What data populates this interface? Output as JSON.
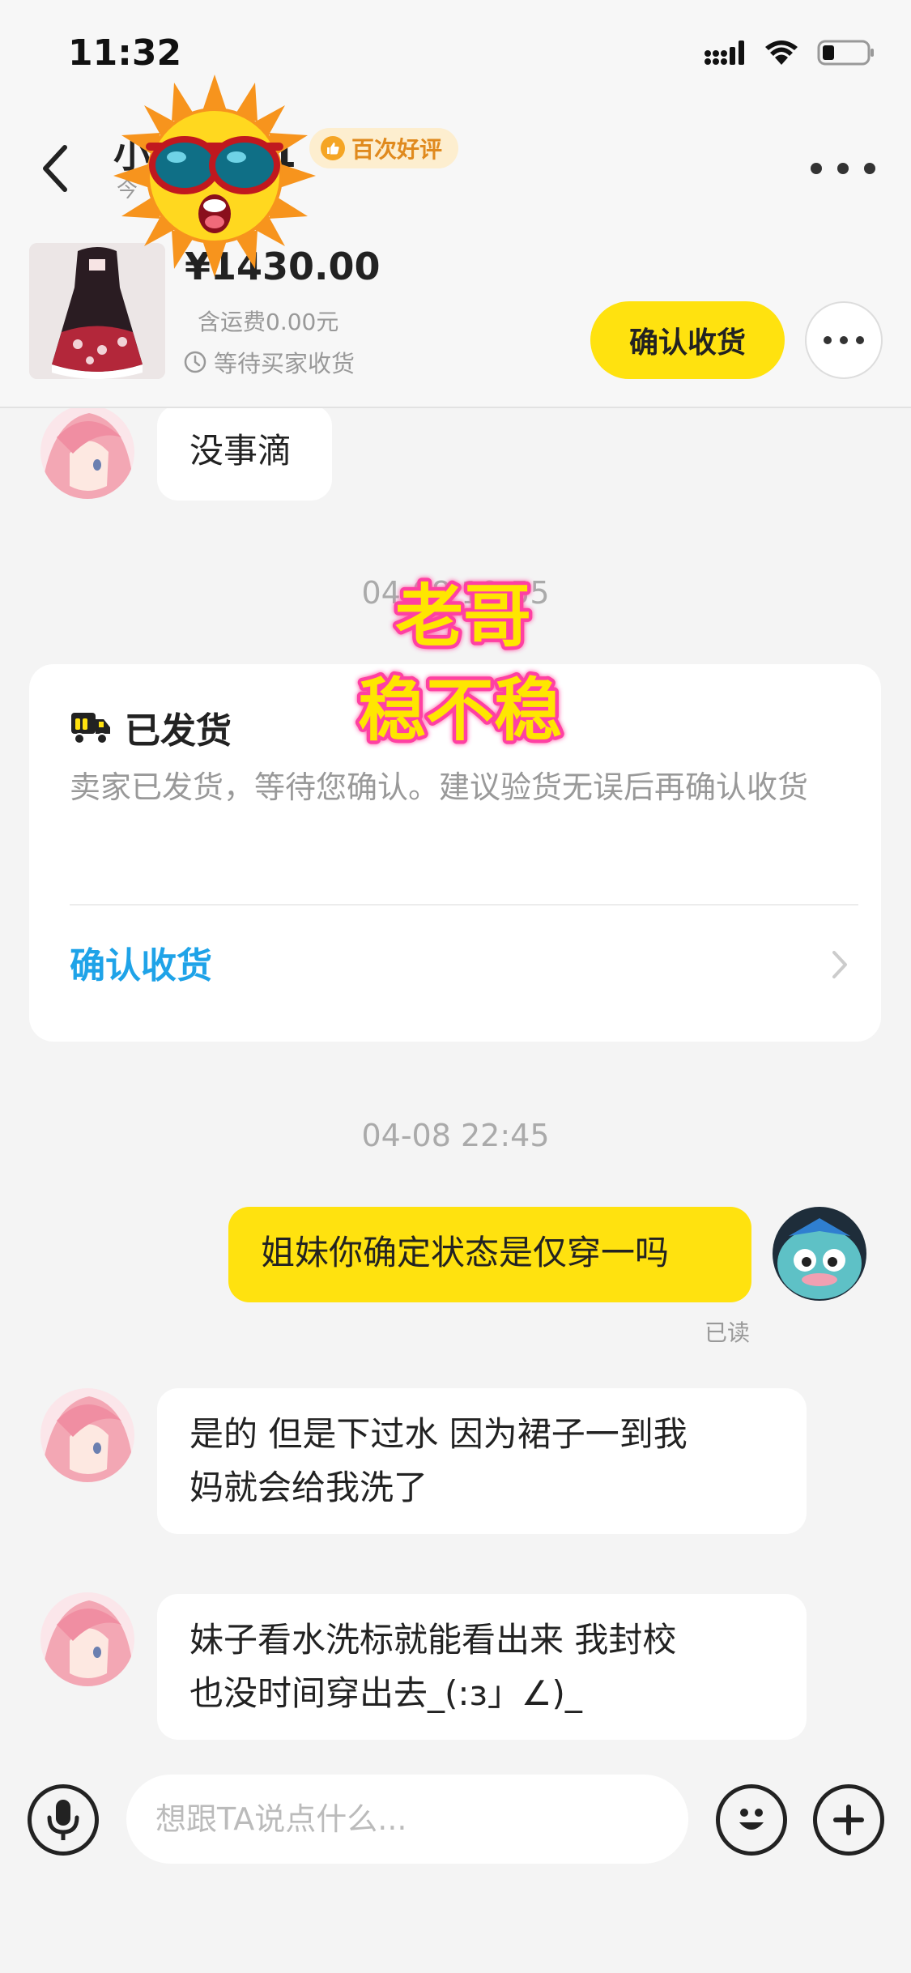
{
  "status_bar": {
    "time": "11:32",
    "icons": [
      "signal-icon",
      "wifi-icon",
      "battery-icon"
    ]
  },
  "header": {
    "title": "小",
    "title_suffix": "1",
    "subtitle": "今",
    "badge": "百次好评",
    "more": "more-icon"
  },
  "order": {
    "price": "¥1430.00",
    "shipping_fee": "含运费0.00元",
    "status": "等待买家收货",
    "confirm_label": "确认收货"
  },
  "messages": [
    {
      "from": "other",
      "text": "没事滴"
    },
    {
      "type": "timestamp",
      "text": "04-08 19:55"
    },
    {
      "type": "shipping_card",
      "title": "已发货",
      "desc": "卖家已发货，等待您确认。建议验货无误后再确认收货",
      "link": "确认收货"
    },
    {
      "type": "timestamp",
      "text": "04-08 22:45"
    },
    {
      "from": "me",
      "text": "姐妹你确定状态是仅穿一吗",
      "read": "已读"
    },
    {
      "from": "other",
      "text_lines": [
        "是的 但是下过水 因为裙子一到我",
        "妈就会给我洗了"
      ]
    },
    {
      "from": "other",
      "text_lines": [
        "妹子看水洗标就能看出来 我封校",
        "也没时间穿出去_(:з」∠)_"
      ]
    }
  ],
  "stickers": {
    "meme_line1": "老哥",
    "meme_line2": "稳不稳"
  },
  "input": {
    "placeholder": "想跟TA说点什么..."
  },
  "colors": {
    "accent_yellow": "#ffe20f",
    "link_blue": "#1fa3e8",
    "badge_orange": "#e08a1e"
  }
}
